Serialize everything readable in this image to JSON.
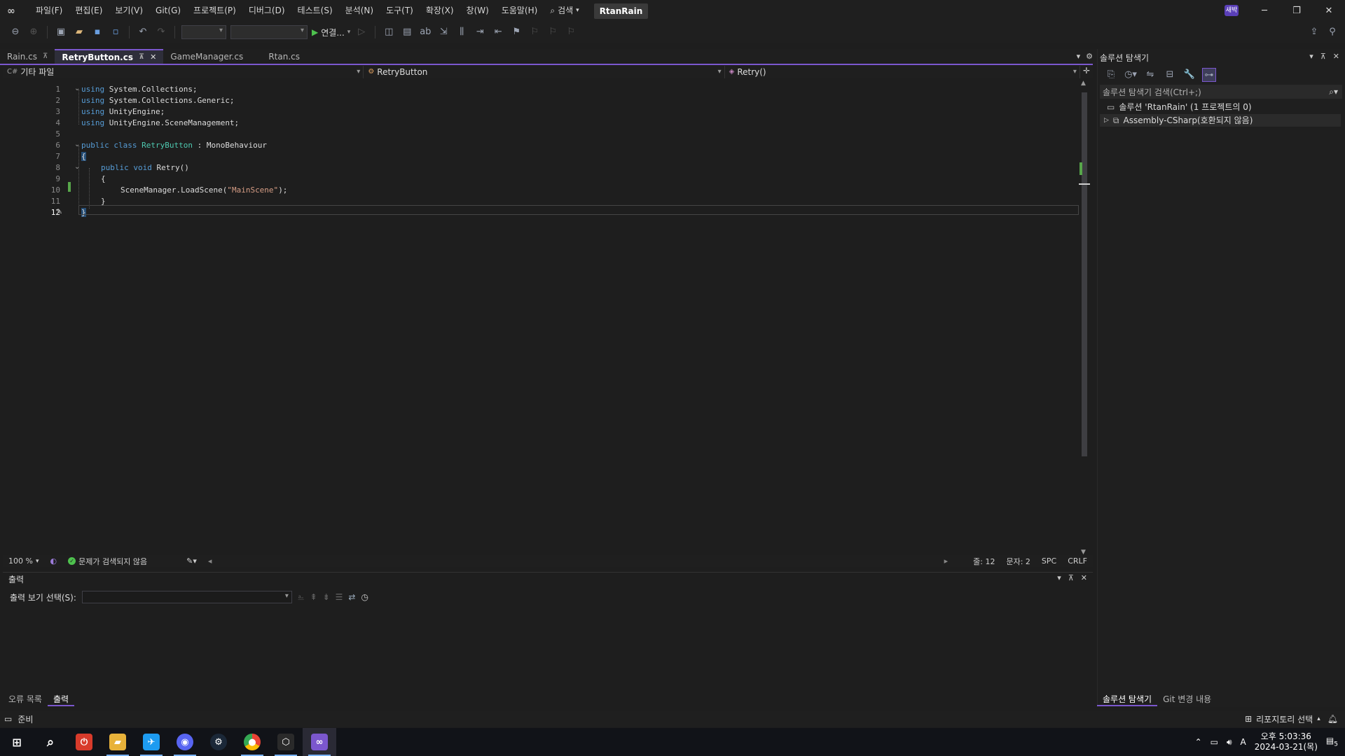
{
  "menubar": {
    "items": [
      "파일(F)",
      "편집(E)",
      "보기(V)",
      "Git(G)",
      "프로젝트(P)",
      "디버그(D)",
      "테스트(S)",
      "분석(N)",
      "도구(T)",
      "확장(X)",
      "창(W)",
      "도움말(H)"
    ],
    "search_label": "검색",
    "solution_name": "RtanRain",
    "avatar_label": "새박"
  },
  "toolbar": {
    "run_label": "연결..."
  },
  "editor_tabs": [
    {
      "label": "Rain.cs",
      "pinned": true,
      "active": false
    },
    {
      "label": "RetryButton.cs",
      "pinned": true,
      "active": true
    },
    {
      "label": "GameManager.cs",
      "pinned": false,
      "active": false
    },
    {
      "label": "Rtan.cs",
      "pinned": false,
      "active": false
    }
  ],
  "navbar": {
    "project": "기타 파일",
    "type": "RetryButton",
    "member": "Retry()"
  },
  "code_lines": [
    {
      "n": "1"
    },
    {
      "n": "2"
    },
    {
      "n": "3"
    },
    {
      "n": "4"
    },
    {
      "n": "5"
    },
    {
      "n": "6"
    },
    {
      "n": "7"
    },
    {
      "n": "8"
    },
    {
      "n": "9"
    },
    {
      "n": "10"
    },
    {
      "n": "11"
    },
    {
      "n": "12"
    }
  ],
  "code": {
    "using": "using",
    "ns1": "System.Collections;",
    "ns2": "System.Collections.Generic;",
    "ns3": "UnityEngine;",
    "ns4": "UnityEngine.SceneManagement;",
    "public": "public",
    "class": "class",
    "class_name": "RetryButton",
    "colon": ":",
    "base_class": "MonoBehaviour",
    "open_brace": "{",
    "void": "void",
    "method_sig": "Retry()",
    "close_brace": "}",
    "call_prefix": "SceneManager.LoadScene(",
    "call_arg": "\"MainScene\"",
    "call_suffix": ");"
  },
  "editor_status": {
    "zoom": "100 %",
    "issues": "문제가 검색되지 않음",
    "line": "줄: 12",
    "char": "문자: 2",
    "spacing": "SPC",
    "eol": "CRLF"
  },
  "output_panel": {
    "title": "출력",
    "source_label": "출력 보기 선택(S):",
    "source_value": ""
  },
  "bottom_tabs": [
    "오류 목록",
    "출력"
  ],
  "solution_explorer": {
    "title": "솔루션 탐색기",
    "search_placeholder": "솔루션 탐색기 검색(Ctrl+;)",
    "solution_node": "솔루션 'RtanRain' (1 프로젝트의 0)",
    "project_node": "Assembly-CSharp(호환되지 않음)",
    "bottom_tabs": [
      "솔루션 탐색기",
      "Git 변경 내용"
    ]
  },
  "app_status": {
    "ready": "준비",
    "repo": "리포지토리 선택"
  },
  "taskbar": {
    "time": "오후 5:03:36",
    "date": "2024-03-21(목)",
    "ime": "A",
    "notifications": "5"
  },
  "colors": {
    "accent": "#7b57ce",
    "keyword": "#569cd6",
    "type": "#4ec9b0",
    "string": "#d69d85",
    "change": "#57a64a"
  }
}
